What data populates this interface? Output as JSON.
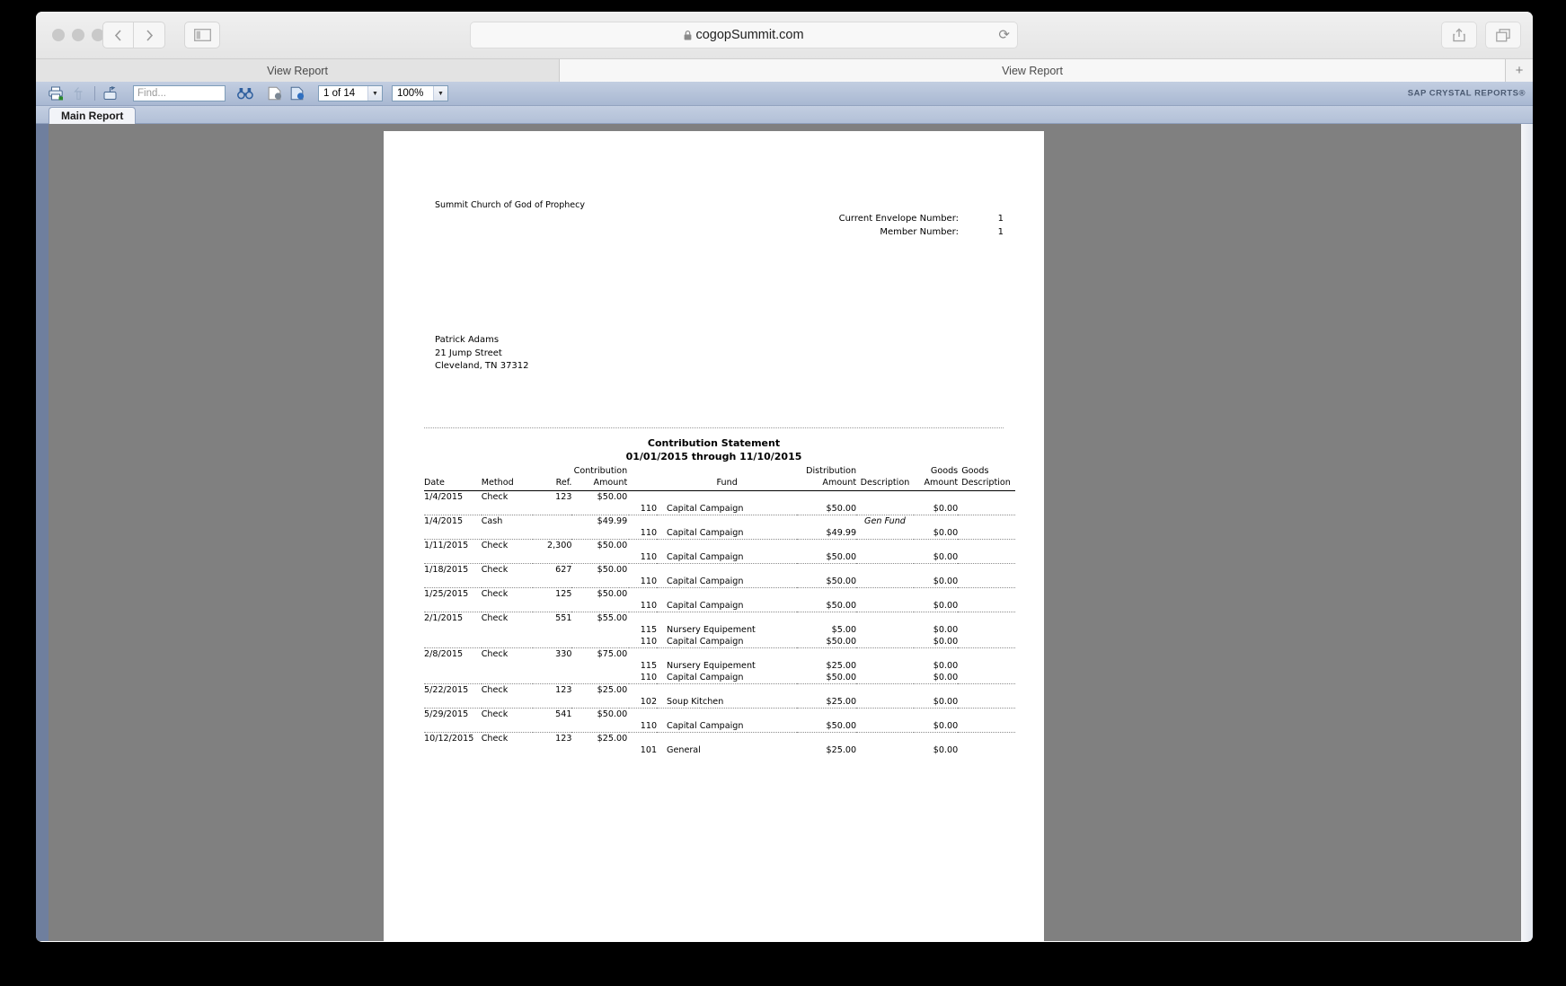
{
  "browser": {
    "url": "cogopSummit.com",
    "url_lock_icon": "lock-icon",
    "reload_icon": "reload-icon",
    "back_icon": "chevron-left-icon",
    "forward_icon": "chevron-right-icon",
    "sidebar_icon": "sidebar-toggle-icon",
    "share_icon": "share-icon",
    "tabs_overview_icon": "tabs-overview-icon",
    "tabs": [
      {
        "label": "View Report",
        "active": false
      },
      {
        "label": "View Report",
        "active": true
      }
    ],
    "new_tab_label": "+"
  },
  "viewer": {
    "toolbar": {
      "print_icon": "printer-icon",
      "export_up_icon": "export-up-arrow-icon",
      "export_icon": "export-icon",
      "find_placeholder": "Find...",
      "find_value": "",
      "binoculars_icon": "binoculars-icon",
      "page_prev_icon": "page-back-icon",
      "page_next_icon": "page-forward-icon",
      "page_value": "1 of 14",
      "zoom_value": "100%",
      "dropdown_arrow": "▼",
      "brand": "SAP CRYSTAL REPORTS®"
    },
    "report_tab": "Main Report"
  },
  "report": {
    "church_name": "Summit Church of God of Prophecy",
    "envelope_label": "Current Envelope Number:",
    "envelope_value": "1",
    "member_label": "Member Number:",
    "member_value": "1",
    "address": "Patrick Adams\n21 Jump Street\nCleveland, TN 37312",
    "statement_title": "Contribution Statement",
    "statement_period": "01/01/2015  through  11/10/2015",
    "columns": {
      "date": "Date",
      "method": "Method",
      "ref": "Ref.",
      "contribution_amount_l1": "Contribution",
      "contribution_amount_l2": "Amount",
      "fund": "Fund",
      "distribution_amount_l1": "Distribution",
      "distribution_amount_l2": "Amount",
      "description": "Description",
      "goods_amount_l1": "Goods",
      "goods_amount_l2": "Amount",
      "goods_description_l1": "Goods",
      "goods_description_l2": "Description"
    },
    "groups": [
      {
        "date": "1/4/2015",
        "method": "Check",
        "ref": "123",
        "amount": "$50.00",
        "description": "",
        "lines": [
          {
            "fund_code": "110",
            "fund": "Capital Campaign",
            "dist_amount": "$50.00",
            "goods_amount": "$0.00",
            "goods_description": ""
          }
        ]
      },
      {
        "date": "1/4/2015",
        "method": "Cash",
        "ref": "",
        "amount": "$49.99",
        "description": "Gen Fund",
        "lines": [
          {
            "fund_code": "110",
            "fund": "Capital Campaign",
            "dist_amount": "$49.99",
            "goods_amount": "$0.00",
            "goods_description": ""
          }
        ]
      },
      {
        "date": "1/11/2015",
        "method": "Check",
        "ref": "2,300",
        "amount": "$50.00",
        "description": "",
        "lines": [
          {
            "fund_code": "110",
            "fund": "Capital Campaign",
            "dist_amount": "$50.00",
            "goods_amount": "$0.00",
            "goods_description": ""
          }
        ]
      },
      {
        "date": "1/18/2015",
        "method": "Check",
        "ref": "627",
        "amount": "$50.00",
        "description": "",
        "lines": [
          {
            "fund_code": "110",
            "fund": "Capital Campaign",
            "dist_amount": "$50.00",
            "goods_amount": "$0.00",
            "goods_description": ""
          }
        ]
      },
      {
        "date": "1/25/2015",
        "method": "Check",
        "ref": "125",
        "amount": "$50.00",
        "description": "",
        "lines": [
          {
            "fund_code": "110",
            "fund": "Capital Campaign",
            "dist_amount": "$50.00",
            "goods_amount": "$0.00",
            "goods_description": ""
          }
        ]
      },
      {
        "date": "2/1/2015",
        "method": "Check",
        "ref": "551",
        "amount": "$55.00",
        "description": "",
        "lines": [
          {
            "fund_code": "115",
            "fund": "Nursery Equipement",
            "dist_amount": "$5.00",
            "goods_amount": "$0.00",
            "goods_description": ""
          },
          {
            "fund_code": "110",
            "fund": "Capital Campaign",
            "dist_amount": "$50.00",
            "goods_amount": "$0.00",
            "goods_description": ""
          }
        ]
      },
      {
        "date": "2/8/2015",
        "method": "Check",
        "ref": "330",
        "amount": "$75.00",
        "description": "",
        "lines": [
          {
            "fund_code": "115",
            "fund": "Nursery Equipement",
            "dist_amount": "$25.00",
            "goods_amount": "$0.00",
            "goods_description": ""
          },
          {
            "fund_code": "110",
            "fund": "Capital Campaign",
            "dist_amount": "$50.00",
            "goods_amount": "$0.00",
            "goods_description": ""
          }
        ]
      },
      {
        "date": "5/22/2015",
        "method": "Check",
        "ref": "123",
        "amount": "$25.00",
        "description": "",
        "lines": [
          {
            "fund_code": "102",
            "fund": "Soup Kitchen",
            "dist_amount": "$25.00",
            "goods_amount": "$0.00",
            "goods_description": ""
          }
        ]
      },
      {
        "date": "5/29/2015",
        "method": "Check",
        "ref": "541",
        "amount": "$50.00",
        "description": "",
        "lines": [
          {
            "fund_code": "110",
            "fund": "Capital Campaign",
            "dist_amount": "$50.00",
            "goods_amount": "$0.00",
            "goods_description": ""
          }
        ]
      },
      {
        "date": "10/12/2015",
        "method": "Check",
        "ref": "123",
        "amount": "$25.00",
        "description": "",
        "lines": [
          {
            "fund_code": "101",
            "fund": "General",
            "dist_amount": "$25.00",
            "goods_amount": "$0.00",
            "goods_description": ""
          }
        ]
      }
    ]
  },
  "colors": {
    "toolbar_blue_top": "#c3cee1",
    "toolbar_blue_bottom": "#a9b8d2",
    "page_bg_gray": "#808080",
    "brand_text": "#4b5a72"
  }
}
